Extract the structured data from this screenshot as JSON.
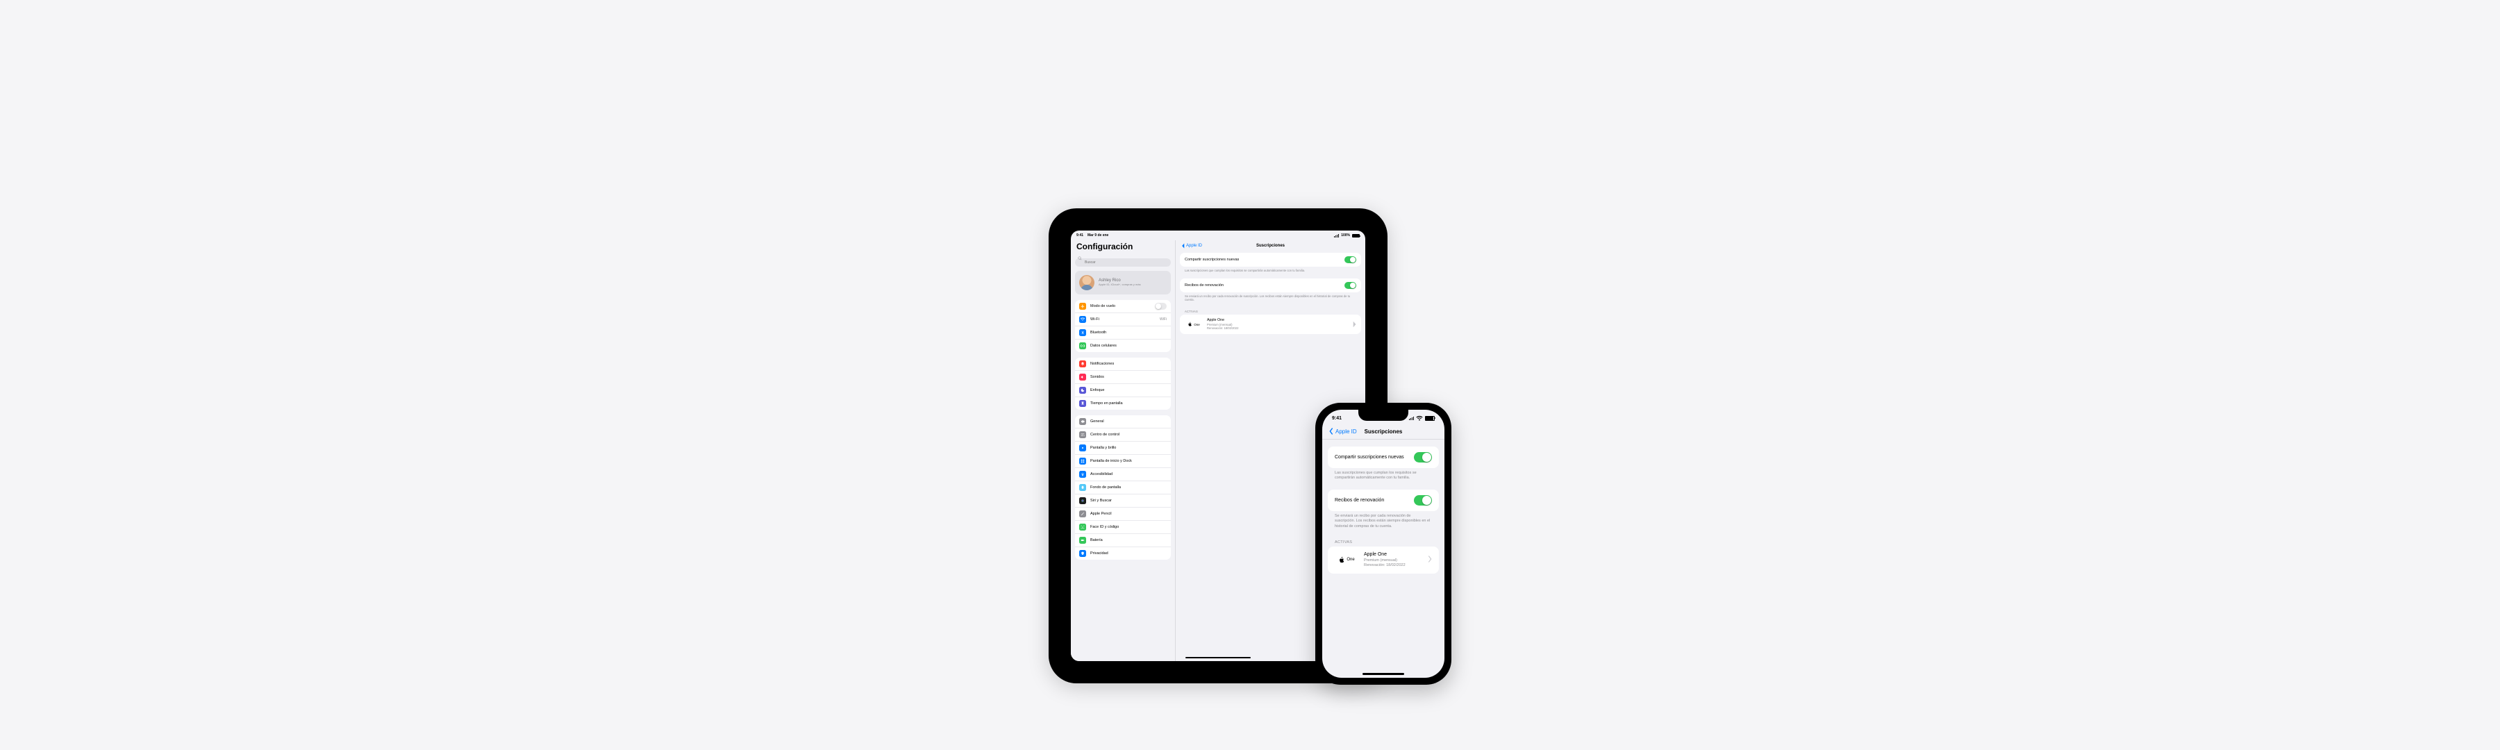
{
  "ipad": {
    "status": {
      "time": "9:41",
      "date": "Mar 9 de ene",
      "pct": "100%"
    },
    "title": "Configuración",
    "search_ph": "Buscar",
    "profile": {
      "name": "Ashley Rico",
      "sub": "Apple ID, iCloud+, compras y más"
    },
    "g1": {
      "airplane": "Modo de vuelo",
      "wifi": "Wi-Fi",
      "wifi_val": "WiFi",
      "bt": "Bluetooth",
      "cell": "Datos celulares"
    },
    "g2": {
      "notif": "Notificaciones",
      "sound": "Sonidos",
      "focus": "Enfoque",
      "screentime": "Tiempo en pantalla"
    },
    "g3": {
      "general": "General",
      "control": "Centro de control",
      "display": "Pantalla y brillo",
      "home": "Pantalla de inicio y Dock",
      "access": "Accesibilidad",
      "wall": "Fondo de pantalla",
      "siri": "Siri y Buscar",
      "pencil": "Apple Pencil",
      "face": "Face ID y código",
      "battery": "Batería",
      "privacy": "Privacidad"
    },
    "detail": {
      "back": "Apple ID",
      "title": "Suscripciones",
      "share_label": "Compartir suscripciones nuevas",
      "share_foot": "Las suscripciones que cumplan los requisitos se compartirán automáticamente con tu familia.",
      "receipt_label": "Recibos de renovación",
      "receipt_foot": "Se enviará un recibo por cada renovación de suscripción. Los recibos están siempre disponibles en el historial de compras de tu cuenta.",
      "active_h": "Activas",
      "sub": {
        "name": "Apple One",
        "line1": "Premium (mensual)",
        "line2": "Renovación: 18/02/2022"
      }
    }
  },
  "iphone": {
    "status": {
      "time": "9:41"
    },
    "back": "Apple ID",
    "title": "Suscripciones",
    "share_label": "Compartir suscripciones nuevas",
    "share_foot": "Las suscripciones que cumplan los requisitos se compartirán automáticamente con tu familia.",
    "receipt_label": "Recibos de renovación",
    "receipt_foot": "Se enviará un recibo por cada renovación de suscripción. Los recibos están siempre disponibles en el historial de compras de tu cuenta.",
    "active_h": "Activas",
    "sub": {
      "name": "Apple One",
      "line1": "Premium (mensual)",
      "line2": "Renovación: 18/02/2022"
    }
  }
}
